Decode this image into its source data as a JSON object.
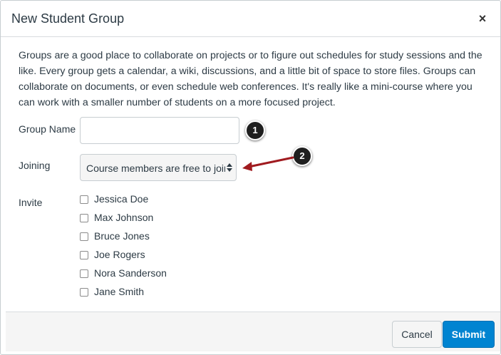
{
  "dialog": {
    "title": "New Student Group",
    "close_glyph": "×"
  },
  "intro": "Groups are a good place to collaborate on projects or to figure out schedules for study sessions and the like. Every group gets a calendar, a wiki, discussions, and a little bit of space to store files. Groups can collaborate on documents, or even schedule web conferences. It's really like a mini-course where you can work with a smaller number of students on a more focused project.",
  "form": {
    "group_name_label": "Group Name",
    "group_name_value": "",
    "joining_label": "Joining",
    "joining_value": "Course members are free to join",
    "invite_label": "Invite",
    "students": [
      {
        "name": "Jessica Doe",
        "checked": false
      },
      {
        "name": "Max Johnson",
        "checked": false
      },
      {
        "name": "Bruce Jones",
        "checked": false
      },
      {
        "name": "Joe Rogers",
        "checked": false
      },
      {
        "name": "Nora Sanderson",
        "checked": false
      },
      {
        "name": "Jane Smith",
        "checked": false
      }
    ]
  },
  "footer": {
    "cancel_label": "Cancel",
    "submit_label": "Submit"
  },
  "callouts": {
    "one": "1",
    "two": "2"
  },
  "colors": {
    "submit_blue": "#0084d1",
    "arrow_red": "#a01a1f",
    "callout_black": "#1f1f1f"
  }
}
